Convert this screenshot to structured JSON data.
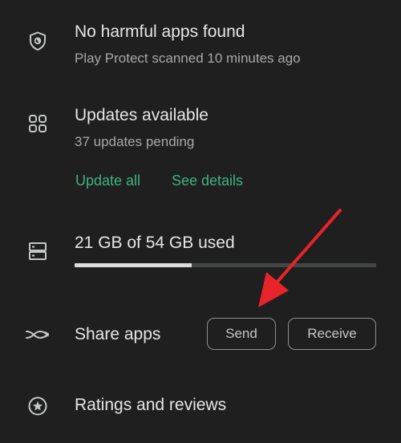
{
  "play_protect": {
    "icon": "shield-icon",
    "title": "No harmful apps found",
    "subtitle": "Play Protect scanned 10 minutes ago"
  },
  "updates": {
    "icon": "grid-apps-icon",
    "title": "Updates available",
    "subtitle": "37 updates pending",
    "update_all_label": "Update all",
    "see_details_label": "See details"
  },
  "storage": {
    "icon": "storage-icon",
    "label": "21 GB of 54 GB used",
    "used_gb": 21,
    "total_gb": 54,
    "used_fraction": 0.389
  },
  "share_apps": {
    "icon": "share-apps-icon",
    "label": "Share apps",
    "send_label": "Send",
    "receive_label": "Receive"
  },
  "ratings": {
    "icon": "star-circle-icon",
    "label": "Ratings and reviews"
  },
  "annotation": {
    "icon": "red-arrow-icon",
    "color": "#e8232a"
  },
  "colors": {
    "background": "#1f1f1f",
    "accent_green": "#3fb27f",
    "text_primary": "#e6e6e6",
    "text_secondary": "#a8a8a8"
  }
}
